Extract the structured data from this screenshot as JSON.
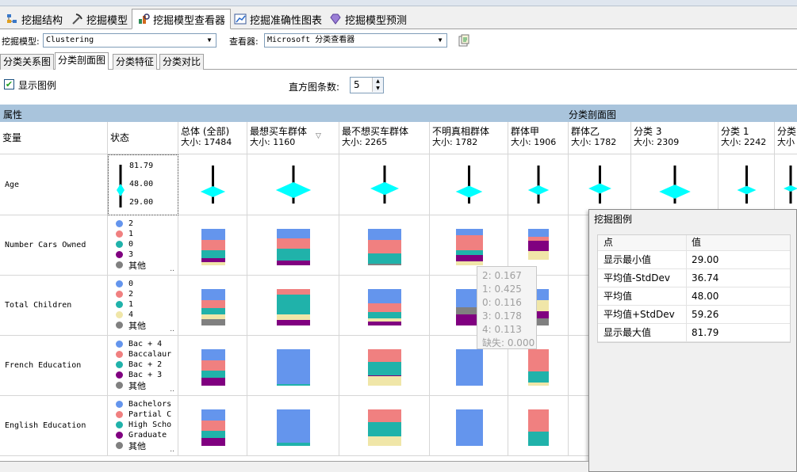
{
  "main_tabs": [
    {
      "label": "挖掘结构",
      "icon": "structure-icon"
    },
    {
      "label": "挖掘模型",
      "icon": "pickaxe-icon"
    },
    {
      "label": "挖掘模型查看器",
      "icon": "viewer-icon"
    },
    {
      "label": "挖掘准确性图表",
      "icon": "chart-icon"
    },
    {
      "label": "挖掘模型预测",
      "icon": "diamond-icon"
    }
  ],
  "toolbar": {
    "model_label": "挖掘模型:",
    "model_value": "Clustering",
    "viewer_label": "查看器:",
    "viewer_value": "Microsoft 分类查看器"
  },
  "sub_tabs": [
    "分类关系图",
    "分类剖面图",
    "分类特征",
    "分类对比"
  ],
  "options": {
    "show_legend_label": "显示图例",
    "show_legend_checked": true,
    "histogram_label": "直方图条数:",
    "histogram_value": "5"
  },
  "header_band": {
    "left": "属性",
    "right": "分类剖面图"
  },
  "grid_headers": {
    "variable": "变量",
    "state": "状态"
  },
  "clusters": [
    {
      "name": "总体 (全部)",
      "size": "大小: 17484"
    },
    {
      "name": "最想买车群体",
      "size": "大小: 1160"
    },
    {
      "name": "最不想买车群体",
      "size": "大小: 2265"
    },
    {
      "name": "不明真相群体",
      "size": "大小: 1782"
    },
    {
      "name": "群体甲",
      "size": "大小: 1906"
    },
    {
      "name": "群体乙",
      "size": "大小: 1782"
    },
    {
      "name": "分类 3",
      "size": "大小: 2309"
    },
    {
      "name": "分类 1",
      "size": "大小: 2242"
    },
    {
      "name": "分类",
      "size": "大小"
    }
  ],
  "colors": {
    "blue": "#6495ed",
    "salmon": "#f08080",
    "teal": "#20b2aa",
    "purple": "#800080",
    "gray": "#808080",
    "khaki": "#f0e6a8",
    "diamond": "#00ffff",
    "header_band": "#a9c4dc"
  },
  "age_state": {
    "max": "81.79",
    "mean": "48.00",
    "min": "29.00"
  },
  "rows": [
    {
      "variable": "Age"
    },
    {
      "variable": "Number Cars Owned",
      "states": [
        {
          "label": "2",
          "color": "blue"
        },
        {
          "label": "1",
          "color": "salmon"
        },
        {
          "label": "0",
          "color": "teal"
        },
        {
          "label": "3",
          "color": "purple"
        },
        {
          "label": "其他",
          "color": "gray"
        }
      ]
    },
    {
      "variable": "Total Children",
      "states": [
        {
          "label": "0",
          "color": "blue"
        },
        {
          "label": "2",
          "color": "salmon"
        },
        {
          "label": "1",
          "color": "teal"
        },
        {
          "label": "4",
          "color": "khaki"
        },
        {
          "label": "其他",
          "color": "gray"
        }
      ]
    },
    {
      "variable": "French Education",
      "states": [
        {
          "label": "Bac + 4",
          "color": "blue"
        },
        {
          "label": "Baccalaur",
          "color": "salmon"
        },
        {
          "label": "Bac + 2",
          "color": "teal"
        },
        {
          "label": "Bac + 3",
          "color": "purple"
        },
        {
          "label": "其他",
          "color": "gray"
        }
      ]
    },
    {
      "variable": "English Education",
      "states": [
        {
          "label": "Bachelors",
          "color": "blue"
        },
        {
          "label": "Partial C",
          "color": "salmon"
        },
        {
          "label": "High Scho",
          "color": "teal"
        },
        {
          "label": "Graduate",
          "color": "purple"
        },
        {
          "label": "其他",
          "color": "gray"
        }
      ]
    }
  ],
  "tooltip": [
    "2: 0.167",
    "1: 0.425",
    "0: 0.116",
    "3: 0.178",
    "4: 0.113",
    "缺失: 0.000"
  ],
  "legend_window": {
    "title": "挖掘图例",
    "columns": [
      "点",
      "值"
    ],
    "rows": [
      {
        "point": "显示最小值",
        "value": "29.00"
      },
      {
        "point": "平均值-StdDev",
        "value": "36.74"
      },
      {
        "point": "平均值",
        "value": "48.00"
      },
      {
        "point": "平均值+StdDev",
        "value": "59.26"
      },
      {
        "point": "显示最大值",
        "value": "81.79"
      }
    ]
  },
  "profile_values": {
    "age_diamond_width": [
      0.52,
      0.74,
      0.6,
      0.56,
      0.44,
      0.48,
      0.66,
      0.4,
      0.3
    ],
    "Number Cars Owned": [
      [
        [
          0.3,
          "blue"
        ],
        [
          0.28,
          "salmon"
        ],
        [
          0.22,
          "teal"
        ],
        [
          0.12,
          "purple"
        ],
        [
          0.08,
          "khaki"
        ]
      ],
      [
        [
          0.25,
          "blue"
        ],
        [
          0.3,
          "salmon"
        ],
        [
          0.32,
          "teal"
        ],
        [
          0.13,
          "purple"
        ]
      ],
      [
        [
          0.3,
          "blue"
        ],
        [
          0.38,
          "salmon"
        ],
        [
          0.28,
          "teal"
        ],
        [
          0.04,
          "gray"
        ]
      ],
      [
        [
          0.17,
          "blue"
        ],
        [
          0.42,
          "salmon"
        ],
        [
          0.12,
          "teal"
        ],
        [
          0.18,
          "purple"
        ],
        [
          0.11,
          "khaki"
        ]
      ],
      [
        [
          0.22,
          "blue"
        ],
        [
          0.1,
          "salmon"
        ],
        [
          0.28,
          "purple"
        ],
        [
          0.25,
          "khaki"
        ]
      ]
    ],
    "Total Children": [
      [
        [
          0.3,
          "blue"
        ],
        [
          0.22,
          "salmon"
        ],
        [
          0.18,
          "teal"
        ],
        [
          0.12,
          "khaki"
        ],
        [
          0.18,
          "gray"
        ]
      ],
      [
        [
          0.15,
          "salmon"
        ],
        [
          0.55,
          "teal"
        ],
        [
          0.15,
          "khaki"
        ],
        [
          0.15,
          "purple"
        ]
      ],
      [
        [
          0.4,
          "blue"
        ],
        [
          0.22,
          "salmon"
        ],
        [
          0.18,
          "teal"
        ],
        [
          0.1,
          "khaki"
        ],
        [
          0.1,
          "purple"
        ]
      ],
      [
        [
          0.5,
          "blue"
        ],
        [
          0.2,
          "gray"
        ],
        [
          0.3,
          "purple"
        ]
      ],
      [
        [
          0.3,
          "blue"
        ],
        [
          0.3,
          "khaki"
        ],
        [
          0.2,
          "purple"
        ],
        [
          0.2,
          "gray"
        ]
      ]
    ],
    "French Education": [
      [
        [
          0.3,
          "blue"
        ],
        [
          0.28,
          "salmon"
        ],
        [
          0.2,
          "teal"
        ],
        [
          0.22,
          "purple"
        ]
      ],
      [
        [
          0.96,
          "blue"
        ],
        [
          0.04,
          "teal"
        ]
      ],
      [
        [
          0.35,
          "salmon"
        ],
        [
          0.37,
          "teal"
        ],
        [
          0.03,
          "purple"
        ],
        [
          0.25,
          "khaki"
        ]
      ],
      [
        [
          1.0,
          "blue"
        ]
      ],
      [
        [
          0.6,
          "salmon"
        ],
        [
          0.32,
          "teal"
        ],
        [
          0.08,
          "khaki"
        ]
      ]
    ],
    "English Education": [
      [
        [
          0.3,
          "blue"
        ],
        [
          0.28,
          "salmon"
        ],
        [
          0.2,
          "teal"
        ],
        [
          0.22,
          "purple"
        ]
      ],
      [
        [
          0.92,
          "blue"
        ],
        [
          0.08,
          "teal"
        ]
      ],
      [
        [
          0.35,
          "salmon"
        ],
        [
          0.38,
          "teal"
        ],
        [
          0.27,
          "khaki"
        ]
      ],
      [
        [
          1.0,
          "blue"
        ]
      ],
      [
        [
          0.6,
          "salmon"
        ],
        [
          0.4,
          "teal"
        ]
      ]
    ]
  }
}
